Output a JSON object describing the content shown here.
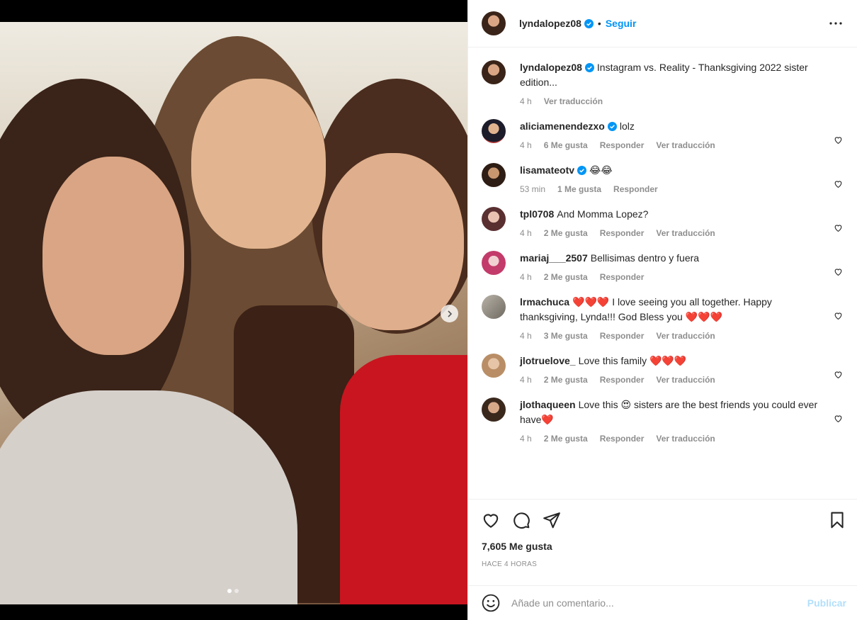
{
  "post": {
    "username": "lyndalopez08",
    "follow_label": "Seguir",
    "bullet": "•",
    "caption_user": "lyndalopez08",
    "caption_text": "Instagram vs. Reality - Thanksgiving 2022 sister edition...",
    "caption_time": "4 h",
    "caption_translate": "Ver traducción"
  },
  "comments": [
    {
      "user": "aliciamenendezxo",
      "verified": true,
      "text": "lolz",
      "time": "4 h",
      "likes": "6 Me gusta",
      "reply": "Responder",
      "translate": "Ver traducción"
    },
    {
      "user": "lisamateotv",
      "verified": true,
      "text": "😂😂",
      "time": "53 min",
      "likes": "1 Me gusta",
      "reply": "Responder",
      "translate": ""
    },
    {
      "user": "tpl0708",
      "verified": false,
      "text": "And Momma Lopez?",
      "time": "4 h",
      "likes": "2 Me gusta",
      "reply": "Responder",
      "translate": "Ver traducción"
    },
    {
      "user": "mariaj___2507",
      "verified": false,
      "text": "Bellisimas dentro y fuera",
      "time": "4 h",
      "likes": "2 Me gusta",
      "reply": "Responder",
      "translate": ""
    },
    {
      "user": "lrmachuca",
      "verified": false,
      "text_pre": "❤️❤️❤️",
      "text": " I love seeing you all together. Happy thanksgiving, Lynda!!! God Bless you ",
      "text_post": "❤️❤️❤️",
      "time": "4 h",
      "likes": "3 Me gusta",
      "reply": "Responder",
      "translate": "Ver traducción"
    },
    {
      "user": "jlotruelove_",
      "verified": false,
      "text": "Love this family ",
      "text_post": "❤️❤️❤️",
      "time": "4 h",
      "likes": "2 Me gusta",
      "reply": "Responder",
      "translate": "Ver traducción"
    },
    {
      "user": "jlothaqueen",
      "verified": false,
      "text": "Love this 😍 sisters are the best friends you could ever have",
      "text_post": "❤️",
      "time": "4 h",
      "likes": "2 Me gusta",
      "reply": "Responder",
      "translate": "Ver traducción"
    }
  ],
  "footer": {
    "likes": "7,605 Me gusta",
    "time": "HACE 4 HORAS",
    "comment_placeholder": "Añade un comentario...",
    "publish_label": "Publicar"
  },
  "carousel": {
    "slide_count": 2,
    "active_index": 0
  },
  "colors": {
    "accent": "#0095f6",
    "publish_disabled": "#b2dffc",
    "muted": "#8e8e8e",
    "text": "#262626"
  },
  "icons": [
    "verified-badge-icon",
    "more-options-icon",
    "heart-icon",
    "comment-icon",
    "share-icon",
    "bookmark-icon",
    "emoji-icon",
    "chevron-right-icon"
  ]
}
